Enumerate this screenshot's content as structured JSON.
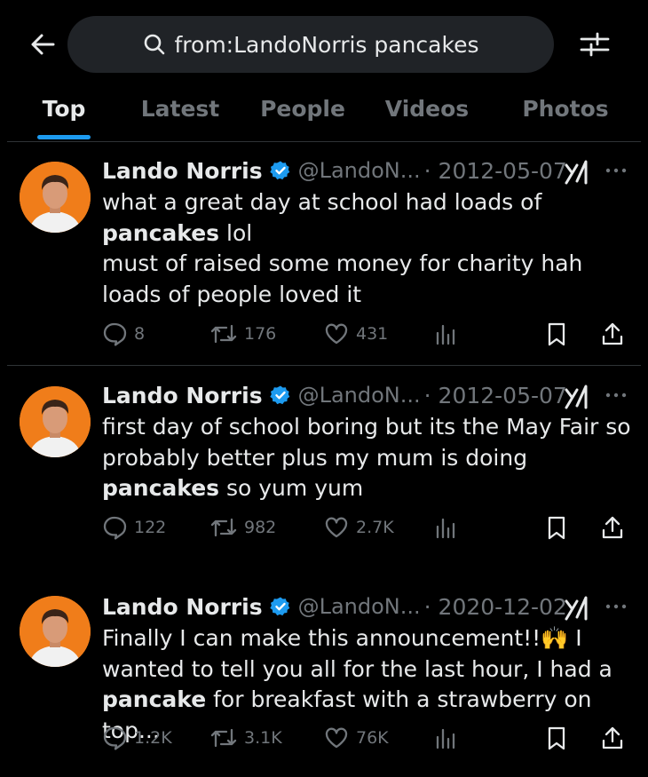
{
  "search": {
    "query": "from:LandoNorris pancakes"
  },
  "tabs": [
    {
      "label": "Top"
    },
    {
      "label": "Latest"
    },
    {
      "label": "People"
    },
    {
      "label": "Videos"
    },
    {
      "label": "Photos"
    }
  ],
  "colors": {
    "accent": "#1d9bf0",
    "background": "#000000",
    "text": "#e7e9ea",
    "muted": "#71767b",
    "avatar_bg": "#f07d1a"
  },
  "icons": [
    "back-arrow-icon",
    "search-icon",
    "filter-sliders-icon",
    "verified-badge-icon",
    "grok-icon",
    "more-icon",
    "reply-icon",
    "retweet-icon",
    "like-icon",
    "views-icon",
    "bookmark-icon",
    "share-icon"
  ],
  "tweets": [
    {
      "name": "Lando Norris",
      "handle": "@LandoN...",
      "date": "· 2012-05-07",
      "text_1": "what a great day at school had loads of ",
      "text_2": "pancakes",
      "text_3": " lol",
      "text_4": "must of raised some money for charity hah",
      "text_5": "loads of people loved it",
      "replies": "8",
      "retweets": "176",
      "likes": "431"
    },
    {
      "name": "Lando Norris",
      "handle": "@LandoN...",
      "date": "· 2012-05-07",
      "text_1": "first day of school boring but its the May Fair so probably better plus my mum is doing ",
      "text_2": "pancakes",
      "text_3": " so yum yum",
      "replies": "122",
      "retweets": "982",
      "likes": "2.7K"
    },
    {
      "name": "Lando Norris",
      "handle": "@LandoN...",
      "date": "· 2020-12-02",
      "text_1": "Finally I can make this announcement!!",
      "emoji": "🙌",
      "text_2": " I wanted to tell you all for the last hour, I had a ",
      "text_3": "pancake",
      "text_4": " for breakfast with a strawberry on top...",
      "replies": "1.2K",
      "retweets": "3.1K",
      "likes": "76K"
    }
  ]
}
